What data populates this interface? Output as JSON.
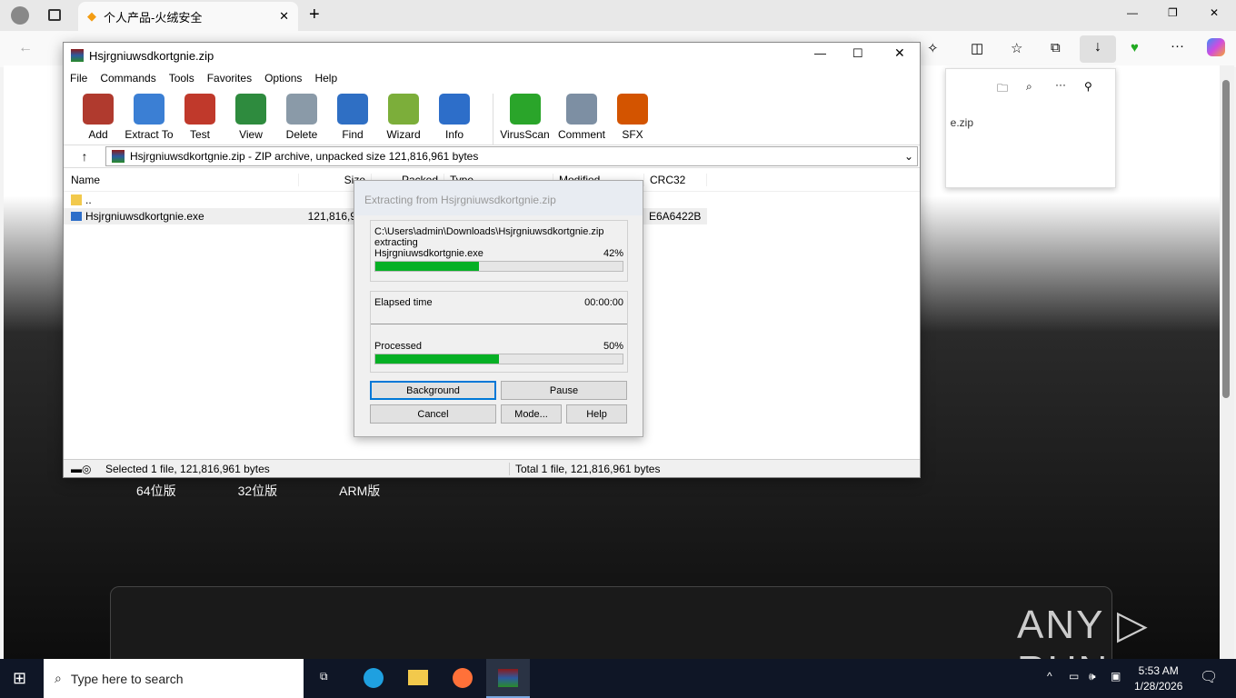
{
  "browser": {
    "tab_title": "个人产品-火绒安全",
    "download_file": "e.zip"
  },
  "page": {
    "versions": [
      "64位版",
      "32位版",
      "ARM版"
    ],
    "watermark": "ANY RUN"
  },
  "winrar": {
    "title": "Hsjrgniuwsdkortgnie.zip",
    "menu": [
      "File",
      "Commands",
      "Tools",
      "Favorites",
      "Options",
      "Help"
    ],
    "toolbar": [
      {
        "label": "Add",
        "color": "#b03a2e"
      },
      {
        "label": "Extract To",
        "color": "#3b7fd4"
      },
      {
        "label": "Test",
        "color": "#c0392b"
      },
      {
        "label": "View",
        "color": "#2e8b3e"
      },
      {
        "label": "Delete",
        "color": "#8a9aa8"
      },
      {
        "label": "Find",
        "color": "#2f6fc4"
      },
      {
        "label": "Wizard",
        "color": "#7cae3a"
      },
      {
        "label": "Info",
        "color": "#2d6ec9"
      },
      {
        "label": "VirusScan",
        "color": "#2aa52a"
      },
      {
        "label": "Comment",
        "color": "#7d8fa3"
      },
      {
        "label": "SFX",
        "color": "#d35400"
      }
    ],
    "path": "Hsjrgniuwsdkortgnie.zip - ZIP archive, unpacked size 121,816,961 bytes",
    "columns": [
      "Name",
      "Size",
      "Packed",
      "Type",
      "Modified",
      "CRC32"
    ],
    "rows": [
      {
        "name": ".."
      },
      {
        "name": "Hsjrgniuwsdkortgnie.exe",
        "size": "121,816,9",
        "crc": "E6A6422B"
      }
    ],
    "status_left": "Selected 1 file, 121,816,961 bytes",
    "status_right": "Total 1 file, 121,816,961 bytes"
  },
  "dialog": {
    "title": "Extracting from Hsjrgniuwsdkortgnie.zip",
    "archive_path": "C:\\Users\\admin\\Downloads\\Hsjrgniuwsdkortgnie.zip",
    "action": "extracting",
    "file": "Hsjrgniuwsdkortgnie.exe",
    "file_pct": "42%",
    "file_progress": 42,
    "elapsed_label": "Elapsed time",
    "elapsed": "00:00:00",
    "processed_label": "Processed",
    "processed_pct": "50%",
    "processed_progress": 50,
    "buttons": {
      "background": "Background",
      "pause": "Pause",
      "cancel": "Cancel",
      "mode": "Mode...",
      "help": "Help"
    }
  },
  "taskbar": {
    "search_placeholder": "Type here to search",
    "time": "5:53 AM",
    "date": "1/28/2026"
  }
}
